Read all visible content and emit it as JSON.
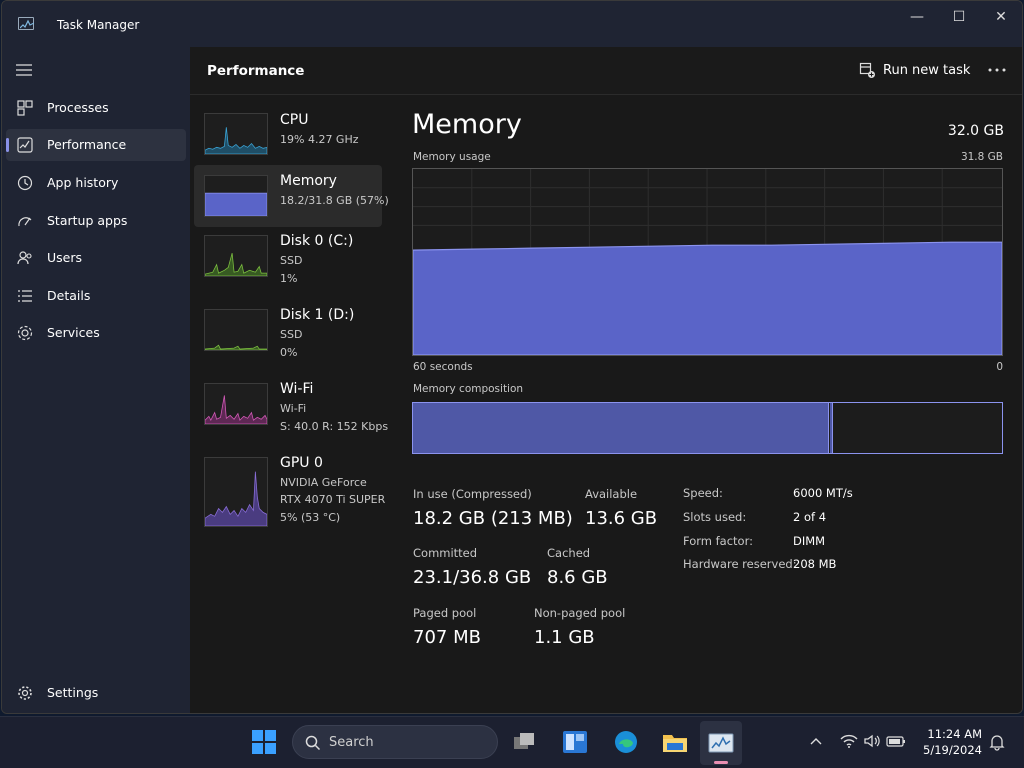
{
  "app": {
    "title": "Task Manager"
  },
  "window_controls": {
    "minimize": "—",
    "maximize": "☐",
    "close": "✕"
  },
  "sidebar": {
    "items": [
      {
        "label": "Processes",
        "icon": "processes-icon"
      },
      {
        "label": "Performance",
        "icon": "performance-icon",
        "active": true
      },
      {
        "label": "App history",
        "icon": "history-icon"
      },
      {
        "label": "Startup apps",
        "icon": "startup-icon"
      },
      {
        "label": "Users",
        "icon": "users-icon"
      },
      {
        "label": "Details",
        "icon": "details-icon"
      },
      {
        "label": "Services",
        "icon": "services-icon"
      }
    ],
    "settings": "Settings"
  },
  "header": {
    "title": "Performance",
    "run_task": "Run new task",
    "more": "..."
  },
  "resources": [
    {
      "name": "CPU",
      "lines": [
        "19%  4.27 GHz"
      ],
      "color": "#3ba6d8"
    },
    {
      "name": "Memory",
      "lines": [
        "18.2/31.8 GB (57%)"
      ],
      "color": "#5a64c8",
      "active": true
    },
    {
      "name": "Disk 0 (C:)",
      "lines": [
        "SSD",
        "1%"
      ],
      "color": "#7dc040"
    },
    {
      "name": "Disk 1 (D:)",
      "lines": [
        "SSD",
        "0%"
      ],
      "color": "#7dc040"
    },
    {
      "name": "Wi-Fi",
      "lines": [
        "Wi-Fi",
        "S:  40.0  R:  152 Kbps"
      ],
      "color": "#d45ab8"
    },
    {
      "name": "GPU 0",
      "lines": [
        "NVIDIA GeForce",
        "RTX 4070 Ti SUPER",
        "5%  (53 °C)"
      ],
      "color": "#8a6ed8"
    }
  ],
  "memory": {
    "title": "Memory",
    "total": "32.0 GB",
    "usage_label": "Memory usage",
    "usage_max": "31.8 GB",
    "axis_left": "60 seconds",
    "axis_right": "0",
    "composition_label": "Memory composition",
    "usage_fraction": 0.57,
    "stats": {
      "in_use_label": "In use (Compressed)",
      "in_use": "18.2 GB (213 MB)",
      "available_label": "Available",
      "available": "13.6 GB",
      "committed_label": "Committed",
      "committed": "23.1/36.8 GB",
      "cached_label": "Cached",
      "cached": "8.6 GB",
      "paged_label": "Paged pool",
      "paged": "707 MB",
      "nonpaged_label": "Non-paged pool",
      "nonpaged": "1.1 GB"
    },
    "details": [
      {
        "key": "Speed:",
        "value": "6000 MT/s"
      },
      {
        "key": "Slots used:",
        "value": "2 of 4"
      },
      {
        "key": "Form factor:",
        "value": "DIMM"
      },
      {
        "key": "Hardware reserved:",
        "value": "208 MB"
      }
    ]
  },
  "taskbar": {
    "search": "Search",
    "time": "11:24 AM",
    "date": "5/19/2024"
  },
  "colors": {
    "accent": "#5a64c8",
    "border_accent": "#8b93ee"
  }
}
